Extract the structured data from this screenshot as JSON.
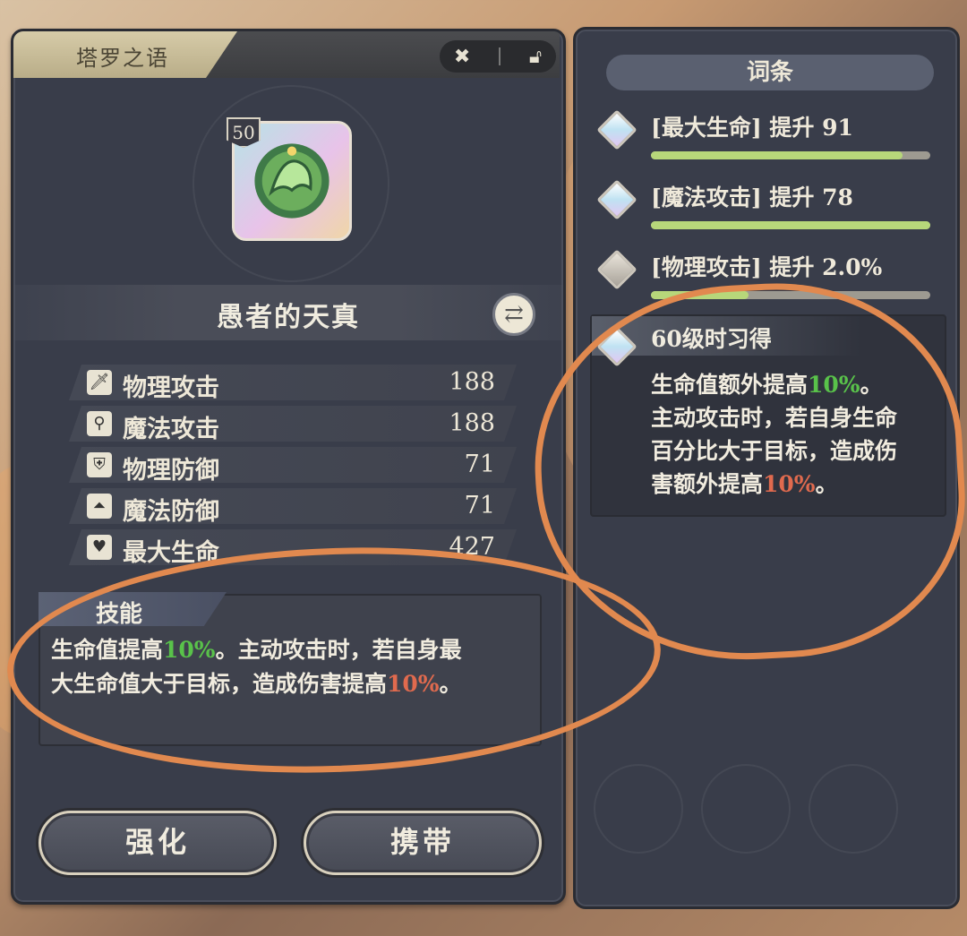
{
  "tarot": {
    "title": "塔罗之语",
    "level": "50",
    "name": "愚者的天真",
    "stats": [
      {
        "label": "物理攻击",
        "value": "188",
        "icon": "sword-icon",
        "glyph": "🗡"
      },
      {
        "label": "魔法攻击",
        "value": "188",
        "icon": "wand-icon",
        "glyph": "⚲"
      },
      {
        "label": "物理防御",
        "value": "71",
        "icon": "shield-icon",
        "glyph": "⛨"
      },
      {
        "label": "魔法防御",
        "value": "71",
        "icon": "witch-hat-icon",
        "glyph": "⏶"
      },
      {
        "label": "最大生命",
        "value": "427",
        "icon": "heart-icon",
        "glyph": "♥"
      }
    ],
    "skill": {
      "title": "技能",
      "line1_a": "生命值提高",
      "line1_pct": "10%",
      "line1_b": "。主动攻击时，若自身最",
      "line2_a": "大生命值大于目标，造成伤害提高",
      "line2_pct": "10%",
      "line2_b": "。"
    },
    "buttons": {
      "enhance": "强化",
      "carry": "携带"
    }
  },
  "affixes": {
    "header": "词条",
    "items": [
      {
        "label": "[最大生命] 提升 91",
        "fill": 0.9
      },
      {
        "label": "[魔法攻击] 提升 78",
        "fill": 1.0
      },
      {
        "label": "[物理攻击] 提升 2.0%",
        "fill": 0.35
      }
    ],
    "unlock": {
      "title": "60级时习得",
      "line1_a": "生命值额外提高",
      "line1_pct": "10%",
      "line1_b": "。",
      "line2": "主动攻击时，若自身生命",
      "line3": "百分比大于目标，造成伤",
      "line4_a": "害额外提高",
      "line4_pct": "10%",
      "line4_b": "。"
    }
  },
  "colors": {
    "annotation": "#e1894f",
    "green": "#59c24a",
    "red": "#e06a4e"
  }
}
